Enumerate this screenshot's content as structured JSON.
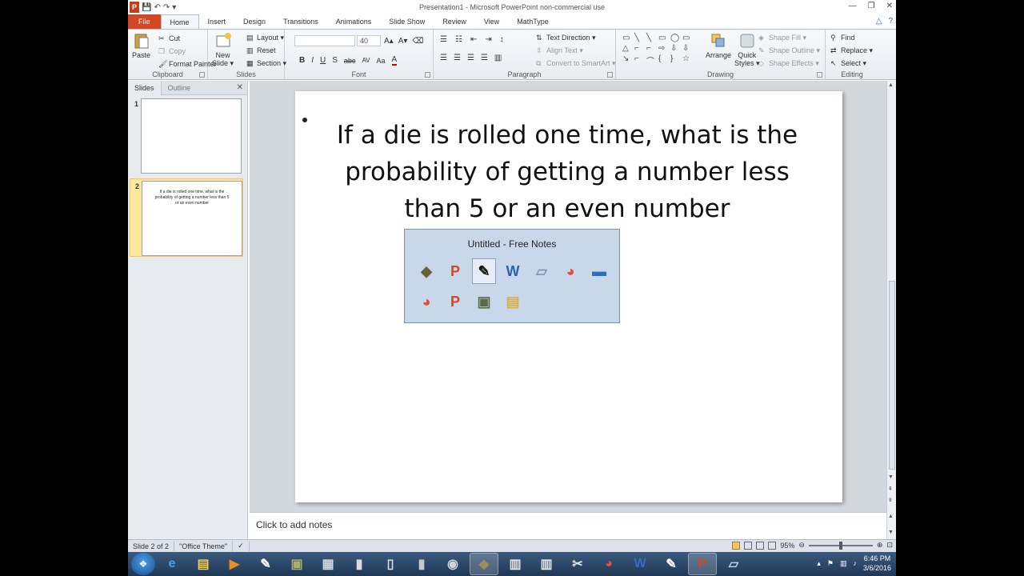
{
  "window": {
    "title": "Presentation1  -  Microsoft PowerPoint non-commercial use",
    "app_icon_letter": "P",
    "qat_save": "💾",
    "qat_undo": "↶",
    "qat_redo": "↷",
    "qat_more": "▾",
    "minimize": "—",
    "restore": "❐",
    "close": "✕"
  },
  "ribbon_tabs": [
    "File",
    "Home",
    "Insert",
    "Design",
    "Transitions",
    "Animations",
    "Slide Show",
    "Review",
    "View",
    "MathType"
  ],
  "help": {
    "collapse": "△",
    "help": "?"
  },
  "clipboard": {
    "label": "Clipboard",
    "paste": "Paste",
    "cut": "Cut",
    "copy": "Copy",
    "format_painter": "Format Painter"
  },
  "slides_group": {
    "label": "Slides",
    "new_slide_1": "New",
    "new_slide_2": "Slide ▾",
    "layout": "Layout ▾",
    "reset": "Reset",
    "section": "Section ▾"
  },
  "font": {
    "label": "Font",
    "size": "40",
    "grow": "A▴",
    "shrink": "A▾",
    "clear": "⌫",
    "bold": "B",
    "italic": "I",
    "underline": "U",
    "shadow": "S",
    "strike": "abc",
    "spacing": "AV",
    "case": "Aa",
    "color": "A"
  },
  "paragraph": {
    "label": "Paragraph",
    "text_direction": "Text Direction ▾",
    "align_text": "Align Text ▾",
    "smartart": "Convert to SmartArt ▾"
  },
  "drawing": {
    "label": "Drawing",
    "shapes": [
      "▭",
      "╲",
      "╲",
      "▭",
      "◯",
      "▭",
      "△",
      "⌐",
      "⌐",
      "⇨",
      "⇩",
      "⇩",
      "↘",
      "⌐",
      "⌒",
      "{",
      "}",
      "☆"
    ],
    "arrange": "Arrange",
    "quick_styles_1": "Quick",
    "quick_styles_2": "Styles ▾",
    "shape_fill": "Shape Fill ▾",
    "shape_outline": "Shape Outline ▾",
    "shape_effects": "Shape Effects ▾"
  },
  "editing": {
    "label": "Editing",
    "find": "Find",
    "replace": "Replace ▾",
    "select": "Select ▾"
  },
  "left_panel": {
    "tab_slides": "Slides",
    "tab_outline": "Outline",
    "close": "✕",
    "slides": [
      {
        "number": "1",
        "text": ""
      },
      {
        "number": "2",
        "text": "If a die is rolled one time, what is the probability of getting a number less than 5 or an even number"
      }
    ]
  },
  "slide": {
    "title": "If a die is rolled one time, what is the probability of getting a number less than 5 or an even number"
  },
  "scroll": {
    "up": "▲",
    "down": "▼",
    "prev": "⇞",
    "next": "⇟"
  },
  "notes": {
    "placeholder": "Click to add notes"
  },
  "status": {
    "slide_of": "Slide 2 of 2",
    "theme": "\"Office Theme\"",
    "check": "✓",
    "zoom": "95%",
    "zoom_out": "⊖",
    "zoom_in": "⊕",
    "fit": "⊡"
  },
  "taskbar": {
    "start": "❖",
    "icons": [
      {
        "name": "ie",
        "glyph": "e",
        "color": "#4aa3e6",
        "active": false
      },
      {
        "name": "folder",
        "glyph": "▤",
        "color": "#f2c94c",
        "active": false
      },
      {
        "name": "media",
        "glyph": "▶",
        "color": "#f08a24",
        "active": false
      },
      {
        "name": "pen",
        "glyph": "✎",
        "color": "#ffffff",
        "active": false
      },
      {
        "name": "app1",
        "glyph": "▣",
        "color": "#a8b06a",
        "active": false
      },
      {
        "name": "calc",
        "glyph": "▦",
        "color": "#cfd6df",
        "active": false
      },
      {
        "name": "remote",
        "glyph": "▮",
        "color": "#d8dde4",
        "active": false
      },
      {
        "name": "device",
        "glyph": "▯",
        "color": "#d8dde4",
        "active": false
      },
      {
        "name": "phone",
        "glyph": "▮",
        "color": "#c3c9d1",
        "active": false
      },
      {
        "name": "webcam",
        "glyph": "◉",
        "color": "#cfd6df",
        "active": false
      },
      {
        "name": "tool",
        "glyph": "◆",
        "color": "#9c8c5a",
        "active": true
      },
      {
        "name": "fax",
        "glyph": "▥",
        "color": "#e5e8ec",
        "active": false
      },
      {
        "name": "printer",
        "glyph": "▥",
        "color": "#e5e8ec",
        "active": false
      },
      {
        "name": "scissors",
        "glyph": "✂",
        "color": "#e5e8ec",
        "active": false
      },
      {
        "name": "chrome",
        "glyph": "◕",
        "color": "#e54d3c",
        "active": false
      },
      {
        "name": "word",
        "glyph": "W",
        "color": "#3a6bc8",
        "active": false
      },
      {
        "name": "pen2",
        "glyph": "✎",
        "color": "#ffffff",
        "active": false
      },
      {
        "name": "ppt",
        "glyph": "P",
        "color": "#d24726",
        "active": true
      },
      {
        "name": "notes",
        "glyph": "▱",
        "color": "#b8d0ea",
        "active": false
      }
    ],
    "tray_arrow": "▴",
    "flag": "⚑",
    "network": "▥",
    "volume": "♪",
    "time": "6:46 PM",
    "date": "3/6/2016"
  },
  "preview": {
    "title": "Untitled - Free Notes",
    "icons": [
      {
        "name": "preview-tool-icon",
        "glyph": "◆",
        "color": "#6b5e3a",
        "active": false
      },
      {
        "name": "preview-ppt-icon",
        "glyph": "P",
        "color": "#d24726",
        "active": false
      },
      {
        "name": "preview-pen-icon",
        "glyph": "✎",
        "color": "#111111",
        "active": true
      },
      {
        "name": "preview-word-icon",
        "glyph": "W",
        "color": "#2f5fb3",
        "active": false
      },
      {
        "name": "preview-notes-icon",
        "glyph": "▱",
        "color": "#7f9bb8",
        "active": false
      },
      {
        "name": "preview-chrome-icon",
        "glyph": "◕",
        "color": "#e54d3c",
        "active": false
      },
      {
        "name": "preview-screen-icon",
        "glyph": "▬",
        "color": "#2a6fb8",
        "active": false
      },
      {
        "name": "preview-chrome2-icon",
        "glyph": "◕",
        "color": "#e54d3c",
        "active": false
      },
      {
        "name": "preview-ppt2-icon",
        "glyph": "P",
        "color": "#d24726",
        "active": false
      },
      {
        "name": "preview-app-icon",
        "glyph": "▣",
        "color": "#5a6a4a",
        "active": false
      },
      {
        "name": "preview-folder-icon",
        "glyph": "▤",
        "color": "#d6b14a",
        "active": false
      }
    ]
  }
}
